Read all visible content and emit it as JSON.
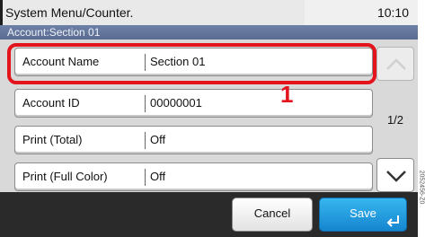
{
  "status_bar": {
    "title": "System Menu/Counter.",
    "time": "10:10"
  },
  "subheader": {
    "path": "Account:Section 01"
  },
  "rows": [
    {
      "label": "Account Name",
      "value": "Section 01"
    },
    {
      "label": "Account ID",
      "value": "00000001"
    },
    {
      "label": "Print (Total)",
      "value": "Off"
    },
    {
      "label": "Print (Full Color)",
      "value": "Off"
    }
  ],
  "pagination": {
    "indicator": "1/2"
  },
  "footer": {
    "cancel_label": "Cancel",
    "save_label": "Save"
  },
  "callout": {
    "number": "1"
  },
  "figure_code": "2052456-Z0",
  "icons": {
    "scroll_up": "chevron-up-icon",
    "scroll_down": "chevron-down-icon",
    "enter": "enter-arrow-icon"
  },
  "colors": {
    "highlight": "#e3141c",
    "save_button": "#1e9be0",
    "subheader": "#62749a"
  }
}
